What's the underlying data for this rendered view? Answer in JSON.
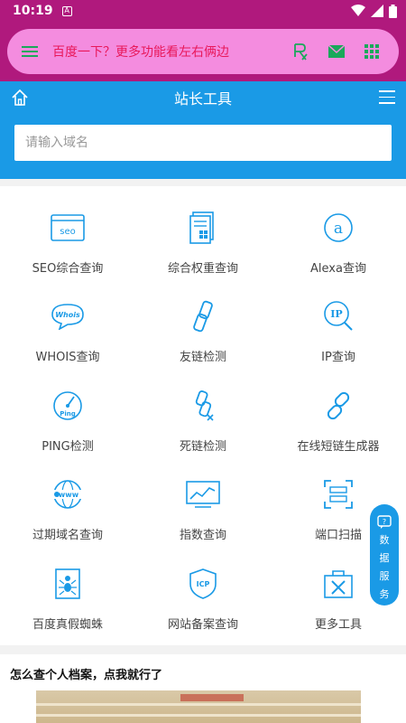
{
  "status_bar": {
    "time": "10:19",
    "app_icon": "A"
  },
  "browser": {
    "text": "百度一下？更多功能看左右俩边",
    "icons": [
      "menu-icon",
      "rx-icon",
      "mail-icon",
      "grid-icon"
    ],
    "colors": {
      "bar": "#b0197d",
      "pill": "#f48cdf",
      "text": "#e8185a",
      "icon": "#1aa85a"
    }
  },
  "header": {
    "title": "站长工具",
    "search_placeholder": "请输入域名"
  },
  "tools": [
    {
      "label": "SEO综合查询",
      "icon": "seo-icon"
    },
    {
      "label": "综合权重查询",
      "icon": "weight-icon"
    },
    {
      "label": "Alexa查询",
      "icon": "alexa-icon"
    },
    {
      "label": "WHOIS查询",
      "icon": "whois-icon"
    },
    {
      "label": "友链检测",
      "icon": "link-icon"
    },
    {
      "label": "IP查询",
      "icon": "ip-icon"
    },
    {
      "label": "PING检测",
      "icon": "ping-icon"
    },
    {
      "label": "死链检测",
      "icon": "dead-link-icon"
    },
    {
      "label": "在线短链生成器",
      "icon": "short-link-icon"
    },
    {
      "label": "过期域名查询",
      "icon": "expired-domain-icon"
    },
    {
      "label": "指数查询",
      "icon": "index-chart-icon"
    },
    {
      "label": "端口扫描",
      "icon": "port-scan-icon"
    },
    {
      "label": "百度真假蜘蛛",
      "icon": "spider-icon"
    },
    {
      "label": "网站备案查询",
      "icon": "icp-icon"
    },
    {
      "label": "更多工具",
      "icon": "toolbox-icon"
    }
  ],
  "float_button": {
    "text": [
      "数",
      "据",
      "服",
      "务"
    ]
  },
  "article": {
    "title": "怎么查个人档案，点我就行了"
  },
  "accent": "#1a9ae6"
}
